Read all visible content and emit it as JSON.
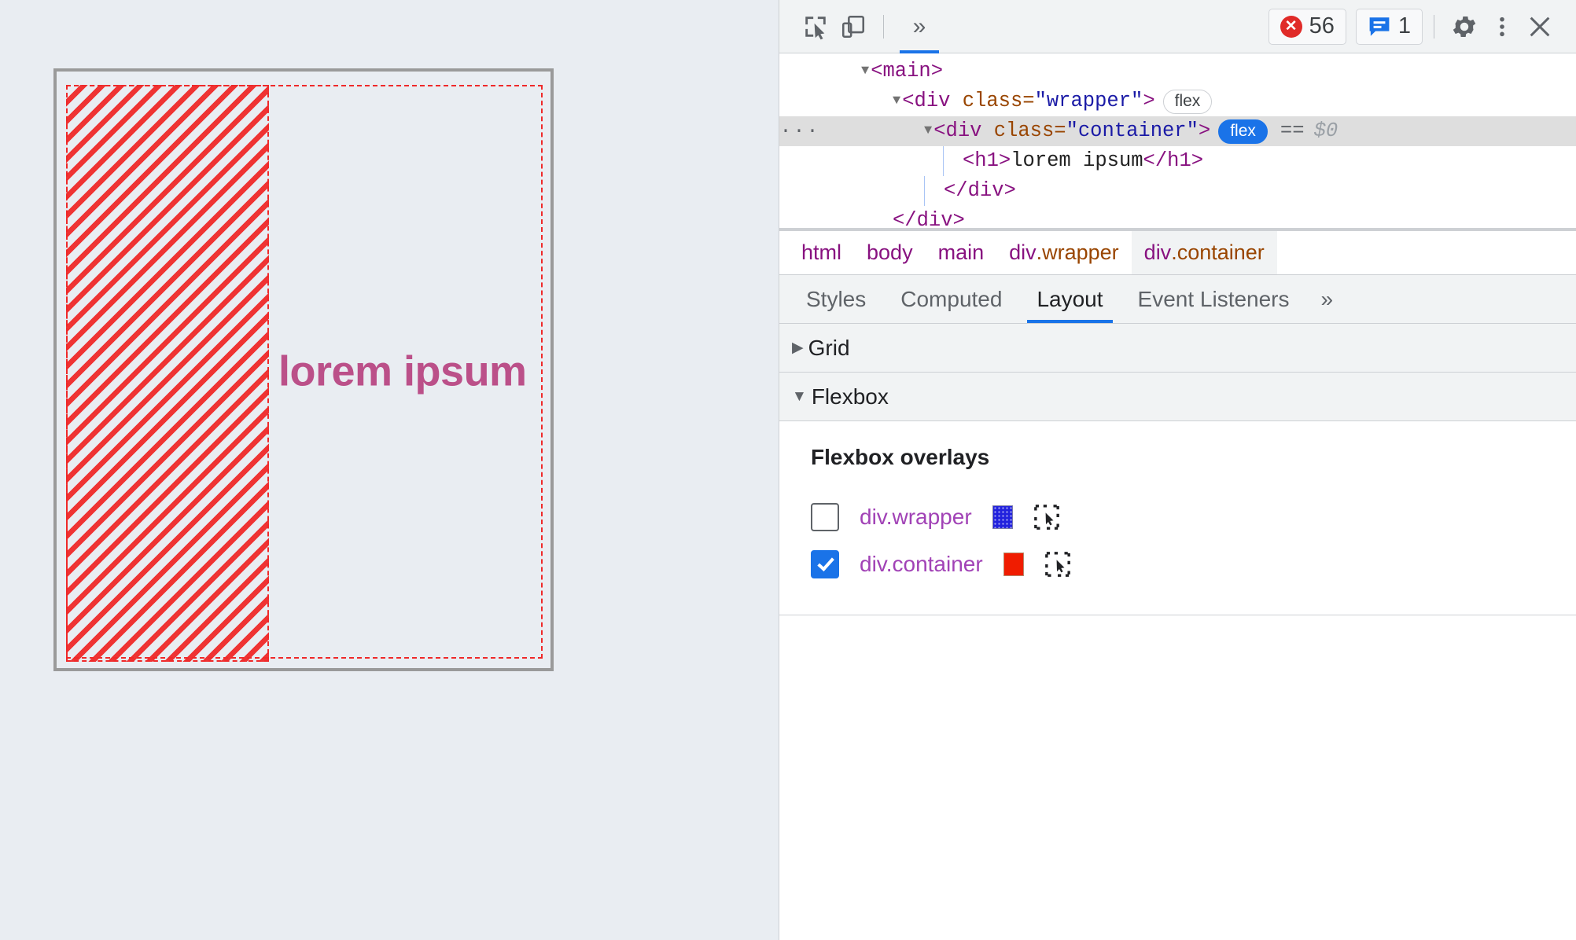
{
  "viewport": {
    "heading": "lorem ipsum",
    "heading_color": "#bb5089",
    "page_background": "#e9edf2",
    "frame_border_color": "#9a9a9a",
    "flex_overlay_color": "#ef2929"
  },
  "devtools": {
    "toolbar": {
      "inspect_icon": "inspect-element-icon",
      "device_icon": "device-toolbar-icon",
      "overflow_label": "»",
      "errors": {
        "count": "56",
        "icon": "error-circle-icon",
        "color": "#e02b28"
      },
      "warnings": {
        "count": "1",
        "icon": "message-bubble-icon",
        "color": "#1a73e8"
      },
      "settings_icon": "gear-icon",
      "more_icon": "more-vertical-icon",
      "close_icon": "close-icon"
    },
    "dom_tree": [
      {
        "id": "main",
        "indent": 1,
        "twisty": "▼",
        "open": "<",
        "tag": "main",
        "close": ">",
        "selected": false
      },
      {
        "id": "wrapper",
        "indent": 2,
        "twisty": "▼",
        "tag": "div",
        "attr_name": "class",
        "attr_value": "\"wrapper\"",
        "badge": "flex",
        "badge_active": false,
        "selected": false
      },
      {
        "id": "container",
        "indent": 3,
        "twisty": "▼",
        "tag": "div",
        "attr_name": "class",
        "attr_value": "\"container\"",
        "badge": "flex",
        "badge_active": true,
        "eqeq": "==",
        "dollar": "$0",
        "selected": true,
        "ellipsis": "···"
      },
      {
        "id": "h1",
        "indent": 4,
        "text_open": "<h1>",
        "text": "lorem ipsum",
        "text_close": "</h1>",
        "selected": false
      },
      {
        "id": "close-container",
        "indent": 3,
        "text_close": "</div>",
        "selected": false
      },
      {
        "id": "close-wrapper",
        "indent": 2,
        "text_close": "</div>",
        "selected": false
      }
    ],
    "breadcrumbs": [
      {
        "label": "html",
        "cls": "",
        "selected": false
      },
      {
        "label": "body",
        "cls": "",
        "selected": false
      },
      {
        "label": "main",
        "cls": "",
        "selected": false
      },
      {
        "label": "div",
        "cls": ".wrapper",
        "selected": false
      },
      {
        "label": "div",
        "cls": ".container",
        "selected": true
      }
    ],
    "tabs": [
      {
        "label": "Styles",
        "active": false
      },
      {
        "label": "Computed",
        "active": false
      },
      {
        "label": "Layout",
        "active": true
      },
      {
        "label": "Event Listeners",
        "active": false
      }
    ],
    "tabs_overflow": "»",
    "sections": [
      {
        "id": "grid",
        "label": "Grid",
        "expanded": false,
        "twisty": "▶"
      },
      {
        "id": "flexbox",
        "label": "Flexbox",
        "expanded": true,
        "twisty": "▼"
      }
    ],
    "flexbox": {
      "overlays_title": "Flexbox overlays",
      "overlays": [
        {
          "label": "div.wrapper",
          "checked": false,
          "color": "#2121dd",
          "pick_icon": "select-element-icon"
        },
        {
          "label": "div.container",
          "checked": true,
          "color": "#f01c00",
          "pick_icon": "select-element-icon"
        }
      ]
    }
  }
}
